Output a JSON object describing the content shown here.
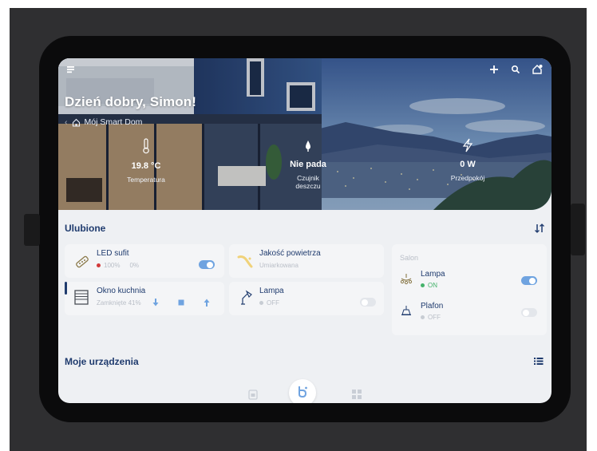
{
  "header": {
    "greeting": "Dzień dobry, Simon!",
    "home_name": "Mój Smart Dom",
    "icons": [
      "menu-icon",
      "plus-icon",
      "search-icon",
      "home-settings-icon"
    ]
  },
  "sensors": [
    {
      "value": "19.8 °C",
      "label": "Temperatura",
      "icon": "thermometer-icon"
    },
    {
      "value": "Nie pada",
      "label": "Czujnik deszczu",
      "icon": "raindrop-icon"
    },
    {
      "value": "0 W",
      "label": "Przedpokój",
      "icon": "lightning-icon"
    }
  ],
  "favorites": {
    "title": "Ulubione",
    "led": {
      "name": "LED sufit",
      "percent": "100%",
      "second": "0%",
      "on": true
    },
    "air": {
      "name": "Jakość powietrza",
      "status": "Umiarkowana"
    },
    "window": {
      "name": "Okno kuchnia",
      "status": "Zamknięte 41%"
    },
    "lamp": {
      "name": "Lampa",
      "status": "OFF",
      "on": false
    },
    "salon": {
      "title": "Salon",
      "lamp": {
        "name": "Lampa",
        "status": "ON",
        "on": true
      },
      "plafon": {
        "name": "Plafon",
        "status": "OFF",
        "on": false
      }
    }
  },
  "devices": {
    "title": "Moje urządzenia"
  },
  "colors": {
    "accent": "#1f3b6e",
    "toggle_on": "#6fa3e0",
    "on_green": "#45b26b",
    "led_red": "#d23a3a"
  }
}
